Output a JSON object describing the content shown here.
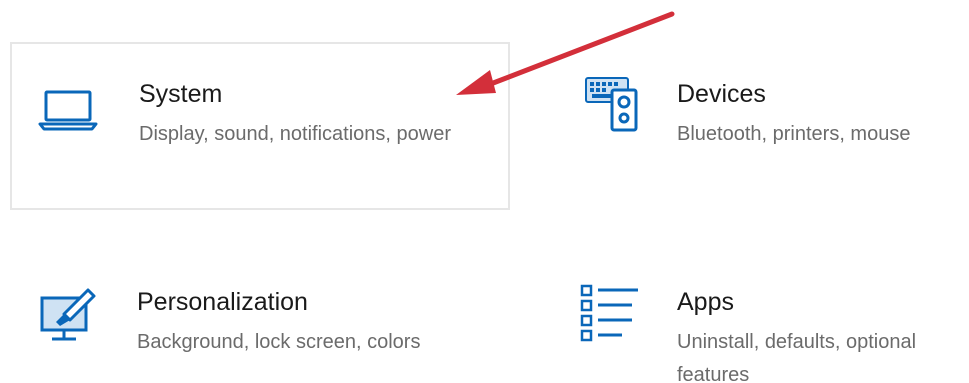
{
  "colors": {
    "icon_accent": "#0a67b9",
    "title_text": "#1a1a1a",
    "description_text": "#6b6b6b",
    "hover_border": "#e6e6e6",
    "annotation_arrow": "#d32f3a"
  },
  "tiles": [
    {
      "icon": "laptop-icon",
      "title": "System",
      "description": "Display, sound, notifications, power"
    },
    {
      "icon": "keyboard-speaker-icon",
      "title": "Devices",
      "description": "Bluetooth, printers, mouse"
    },
    {
      "icon": "paintbrush-monitor-icon",
      "title": "Personalization",
      "description": "Background, lock screen, colors"
    },
    {
      "icon": "apps-list-icon",
      "title": "Apps",
      "description": "Uninstall, defaults, optional features"
    }
  ]
}
